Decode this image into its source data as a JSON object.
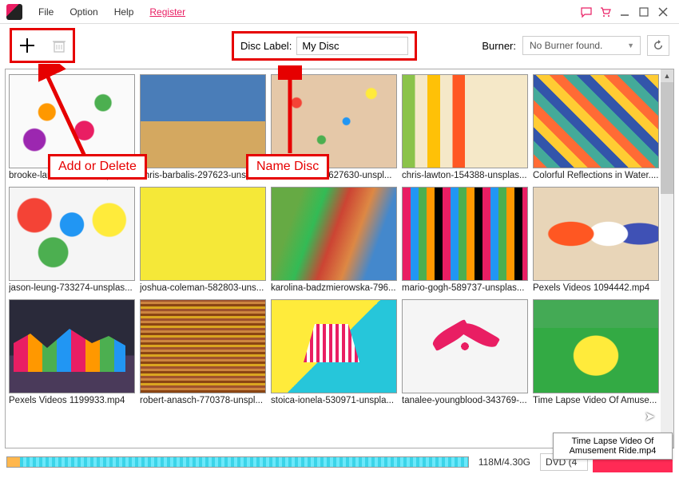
{
  "menu": {
    "file": "File",
    "option": "Option",
    "help": "Help",
    "register": "Register"
  },
  "toolbar": {
    "disc_label_text": "Disc Label:",
    "disc_label_value": "My Disc",
    "burner_text": "Burner:",
    "burner_value": "No Burner found."
  },
  "thumbs": [
    {
      "label": "brooke-lark-235088-unsplas..."
    },
    {
      "label": "chris-barbalis-297623-unspl..."
    },
    {
      "label": "chris-barbalis-627630-unspl..."
    },
    {
      "label": "chris-lawton-154388-unsplas..."
    },
    {
      "label": "Colorful Reflections in Water...."
    },
    {
      "label": "jason-leung-733274-unsplas..."
    },
    {
      "label": "joshua-coleman-582803-uns..."
    },
    {
      "label": "karolina-badzmierowska-796..."
    },
    {
      "label": "mario-gogh-589737-unsplas..."
    },
    {
      "label": "Pexels Videos 1094442.mp4"
    },
    {
      "label": "Pexels Videos 1199933.mp4"
    },
    {
      "label": "robert-anasch-770378-unspl..."
    },
    {
      "label": "stoica-ionela-530971-unspla..."
    },
    {
      "label": "tanalee-youngblood-343769-..."
    },
    {
      "label": "Time Lapse Video Of Amuse..."
    }
  ],
  "bottom": {
    "size": "118M/4.30G",
    "dvd": "DVD (4"
  },
  "callouts": {
    "add_delete": "Add or Delete",
    "name_disc": "Name Disc"
  },
  "tooltip": "Time Lapse Video Of Amusement Ride.mp4"
}
